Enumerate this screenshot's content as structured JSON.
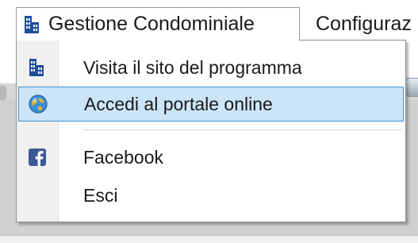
{
  "menubar": {
    "open_menu_label": "Gestione Condominiale",
    "next_menu_label": "Configuraz"
  },
  "dropdown": {
    "items": [
      {
        "label": "Visita il sito del programma",
        "icon": "building-icon",
        "highlighted": false
      },
      {
        "label": "Accedi al portale online",
        "icon": "globe-icon",
        "highlighted": true
      },
      {
        "label": "Facebook",
        "icon": "facebook-icon",
        "highlighted": false
      },
      {
        "label": "Esci",
        "icon": "",
        "highlighted": false
      }
    ]
  },
  "colors": {
    "highlight_fill": "#cce4f7",
    "highlight_border": "#3d8fd6",
    "building_icon": "#1f4e99",
    "facebook_icon": "#3b5998"
  }
}
